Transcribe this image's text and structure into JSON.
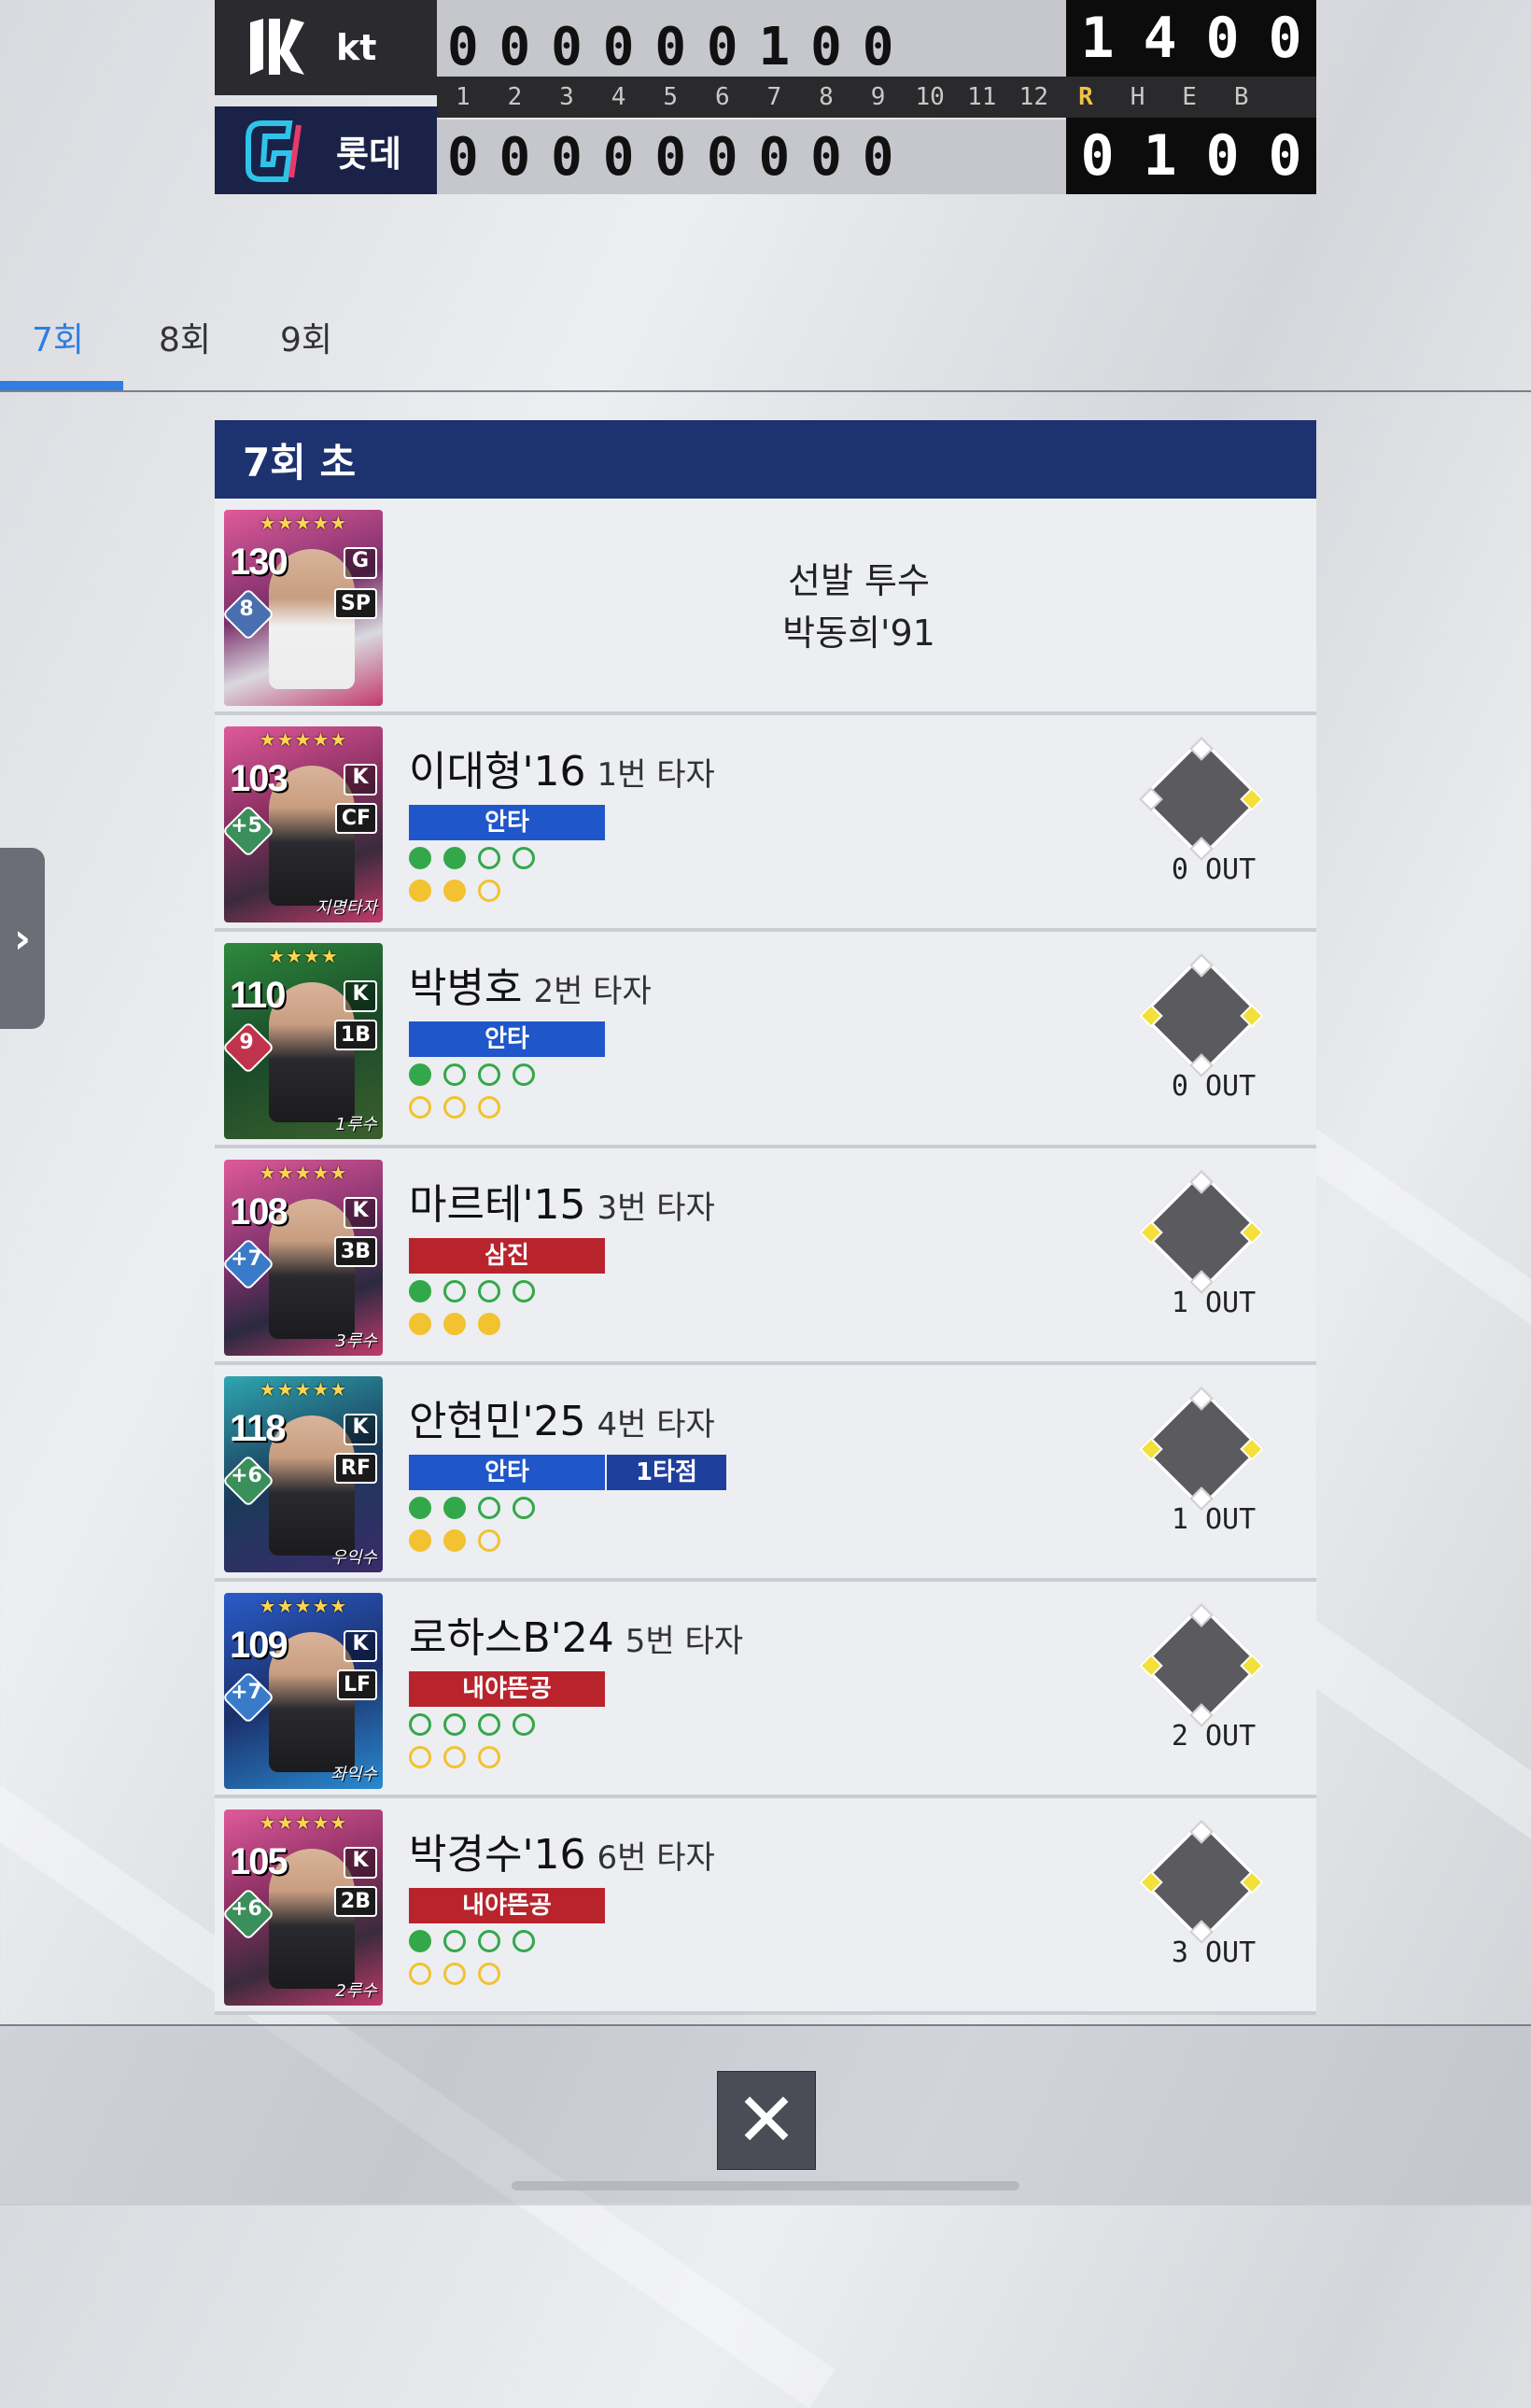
{
  "scoreboard": {
    "innings_header": [
      "1",
      "2",
      "3",
      "4",
      "5",
      "6",
      "7",
      "8",
      "9",
      "10",
      "11",
      "12",
      "R",
      "H",
      "E",
      "B"
    ],
    "away": {
      "team": "kt",
      "innings": [
        "0",
        "0",
        "0",
        "0",
        "0",
        "0",
        "1",
        "0",
        "0"
      ],
      "totals": [
        "1",
        "4",
        "0",
        "0"
      ]
    },
    "home": {
      "team": "롯데",
      "innings": [
        "0",
        "0",
        "0",
        "0",
        "0",
        "0",
        "0",
        "0",
        "0"
      ],
      "totals": [
        "0",
        "1",
        "0",
        "0"
      ]
    }
  },
  "tabs": [
    "7회",
    "8회",
    "9회"
  ],
  "active_tab": "7회",
  "section_title": "7회 초",
  "starter": {
    "label": "선발 투수",
    "name": "박동희'91",
    "card": {
      "ovr": "130",
      "boost": "8",
      "pos": "SP",
      "logo": "G",
      "tag": "",
      "stars": "★★★★★"
    }
  },
  "at_bats": [
    {
      "name": "이대형'16",
      "order": "1번 타자",
      "results": [
        "안타"
      ],
      "rbi": "",
      "balls": [
        true,
        true,
        false,
        false
      ],
      "strikes": [
        true,
        true,
        false
      ],
      "bases": {
        "first": true,
        "second": false,
        "third": false
      },
      "outs": "0 OUT",
      "card": {
        "ovr": "103",
        "boost": "+5",
        "pos": "CF",
        "tag": "지명타자",
        "stars": "★★★★★"
      }
    },
    {
      "name": "박병호",
      "order": "2번 타자",
      "results": [
        "안타"
      ],
      "rbi": "",
      "balls": [
        true,
        false,
        false,
        false
      ],
      "strikes": [
        false,
        false,
        false
      ],
      "bases": {
        "first": true,
        "second": false,
        "third": true
      },
      "outs": "0 OUT",
      "card": {
        "ovr": "110",
        "boost": "9",
        "pos": "1B",
        "tag": "1루수",
        "stars": "★★★★"
      }
    },
    {
      "name": "마르테'15",
      "order": "3번 타자",
      "results": [
        "삼진"
      ],
      "rbi": "",
      "balls": [
        true,
        false,
        false,
        false
      ],
      "strikes": [
        true,
        true,
        true
      ],
      "bases": {
        "first": true,
        "second": false,
        "third": true
      },
      "outs": "1 OUT",
      "card": {
        "ovr": "108",
        "boost": "+7",
        "pos": "3B",
        "tag": "3루수",
        "stars": "★★★★★"
      }
    },
    {
      "name": "안현민'25",
      "order": "4번 타자",
      "results": [
        "안타"
      ],
      "rbi": "1타점",
      "balls": [
        true,
        true,
        false,
        false
      ],
      "strikes": [
        true,
        true,
        false
      ],
      "bases": {
        "first": true,
        "second": false,
        "third": true
      },
      "outs": "1 OUT",
      "card": {
        "ovr": "118",
        "boost": "+6",
        "pos": "RF",
        "tag": "우익수",
        "stars": "★★★★★"
      }
    },
    {
      "name": "로하스B'24",
      "order": "5번 타자",
      "results": [
        "내야뜬공"
      ],
      "rbi": "",
      "balls": [
        false,
        false,
        false,
        false
      ],
      "strikes": [
        false,
        false,
        false
      ],
      "bases": {
        "first": true,
        "second": false,
        "third": true
      },
      "outs": "2 OUT",
      "card": {
        "ovr": "109",
        "boost": "+7",
        "pos": "LF",
        "tag": "좌익수",
        "stars": "★★★★★"
      }
    },
    {
      "name": "박경수'16",
      "order": "6번 타자",
      "results": [
        "내야뜬공"
      ],
      "rbi": "",
      "balls": [
        true,
        false,
        false,
        false
      ],
      "strikes": [
        false,
        false,
        false
      ],
      "bases": {
        "first": true,
        "second": false,
        "third": true
      },
      "outs": "3 OUT",
      "card": {
        "ovr": "105",
        "boost": "+6",
        "pos": "2B",
        "tag": "2루수",
        "stars": "★★★★★"
      }
    }
  ],
  "colors": {
    "header_navy": "#1d3370",
    "tab_active": "#2f7ee0",
    "hit_blue": "#1f56c9",
    "out_red": "#b8232c",
    "ball_green": "#33a84a",
    "strike_yellow": "#f2c230"
  },
  "close_icon": "close-icon",
  "side_handle_icon": "chevron-right-icon"
}
